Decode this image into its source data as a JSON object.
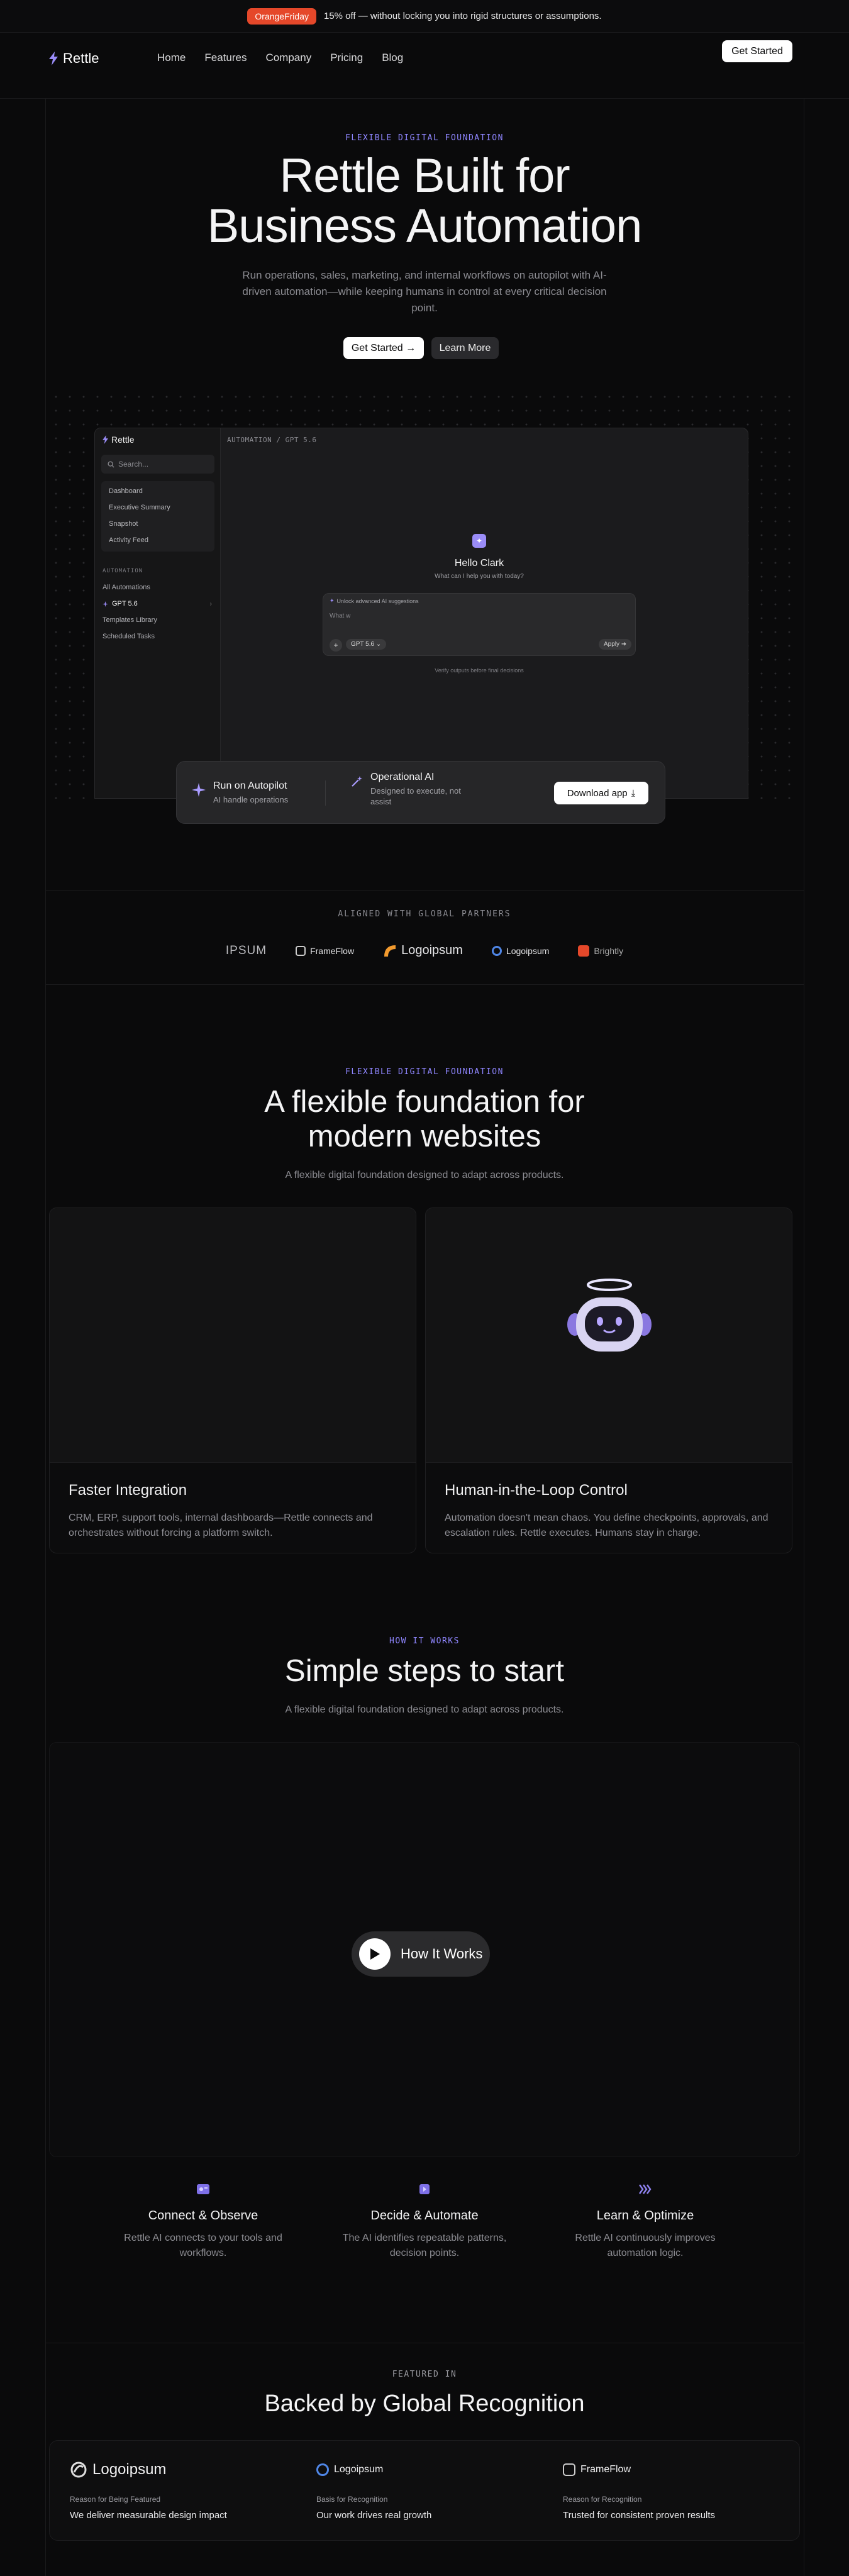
{
  "announcement": {
    "badge": "OrangeFriday",
    "text": "15% off — without locking you into rigid structures or assumptions."
  },
  "nav": {
    "brand": "Rettle",
    "links": [
      "Home",
      "Features",
      "Company",
      "Pricing",
      "Blog"
    ],
    "cta": "Get Started"
  },
  "hero": {
    "eyebrow": "FLEXIBLE DIGITAL FOUNDATION",
    "title_line1": "Rettle Built for",
    "title_line2": "Business Automation",
    "subtitle": "Run operations, sales, marketing, and internal workflows on autopilot with AI-driven automation—while keeping humans in control at every critical decision point.",
    "primary_button": "Get Started →",
    "secondary_button": "Learn More"
  },
  "app_preview": {
    "brand": "Rettle",
    "search_placeholder": "Search...",
    "menu": [
      "Dashboard",
      "Executive Summary",
      "Snapshot",
      "Activity Feed"
    ],
    "section_label": "AUTOMATION",
    "list": [
      "All Automations",
      "GPT 5.6",
      "Templates Library",
      "Scheduled Tasks"
    ],
    "breadcrumb": "AUTOMATION / GPT 5.6",
    "greeting": "Hello Clark",
    "help": "What can I help you with today?",
    "chat_banner": "Unlock advanced AI suggestions",
    "chat_placeholder": "What w",
    "model": "GPT 5.6",
    "apply": "Apply",
    "hint": "Verify outputs before final decisions"
  },
  "feature_strip": {
    "item1_title": "Run on Autopilot",
    "item1_desc": "AI handle operations",
    "item2_title": "Operational AI",
    "item2_desc": "Designed to execute, not assist",
    "cta": "Download app"
  },
  "partners": {
    "label": "ALIGNED WITH GLOBAL PARTNERS",
    "logos": [
      "IPSUM",
      "FrameFlow",
      "Logoipsum",
      "Logoipsum",
      "Brightly"
    ]
  },
  "foundation": {
    "eyebrow": "FLEXIBLE DIGITAL FOUNDATION",
    "title_line1": "A flexible foundation for",
    "title_line2": "modern websites",
    "subtitle": "A flexible digital foundation designed to adapt across products.",
    "cards": [
      {
        "title": "Faster Integration",
        "desc": "CRM, ERP, support tools, internal dashboards—Rettle connects and orchestrates without forcing a platform switch."
      },
      {
        "title": "Human-in-the-Loop Control",
        "desc": "Automation doesn't mean chaos. You define checkpoints, approvals, and escalation rules. Rettle executes. Humans stay in charge."
      }
    ]
  },
  "how": {
    "eyebrow": "HOW IT WORKS",
    "title": "Simple steps to start",
    "subtitle": "A flexible digital foundation designed to adapt across products.",
    "play_label": "How It Works",
    "steps": [
      {
        "title": "Connect & Observe",
        "desc": "Rettle AI connects to your tools and workflows."
      },
      {
        "title": "Decide & Automate",
        "desc": "The AI identifies repeatable patterns, decision points."
      },
      {
        "title": "Learn & Optimize",
        "desc": "Rettle AI continuously improves automation logic."
      }
    ]
  },
  "featured": {
    "eyebrow": "FEATURED IN",
    "title": "Backed by Global Recognition",
    "items": [
      {
        "logo": "Logoipsum",
        "label": "Reason for Being Featured",
        "text": "We deliver measurable design impact"
      },
      {
        "logo": "Logoipsum",
        "label": "Basis for Recognition",
        "text": "Our work drives real growth"
      },
      {
        "logo": "FrameFlow",
        "label": "Reason for Recognition",
        "text": "Trusted for consistent proven results"
      }
    ]
  },
  "colors": {
    "accent": "#8f86ff",
    "badge": "#e5482a",
    "background": "#0a0a0b"
  }
}
